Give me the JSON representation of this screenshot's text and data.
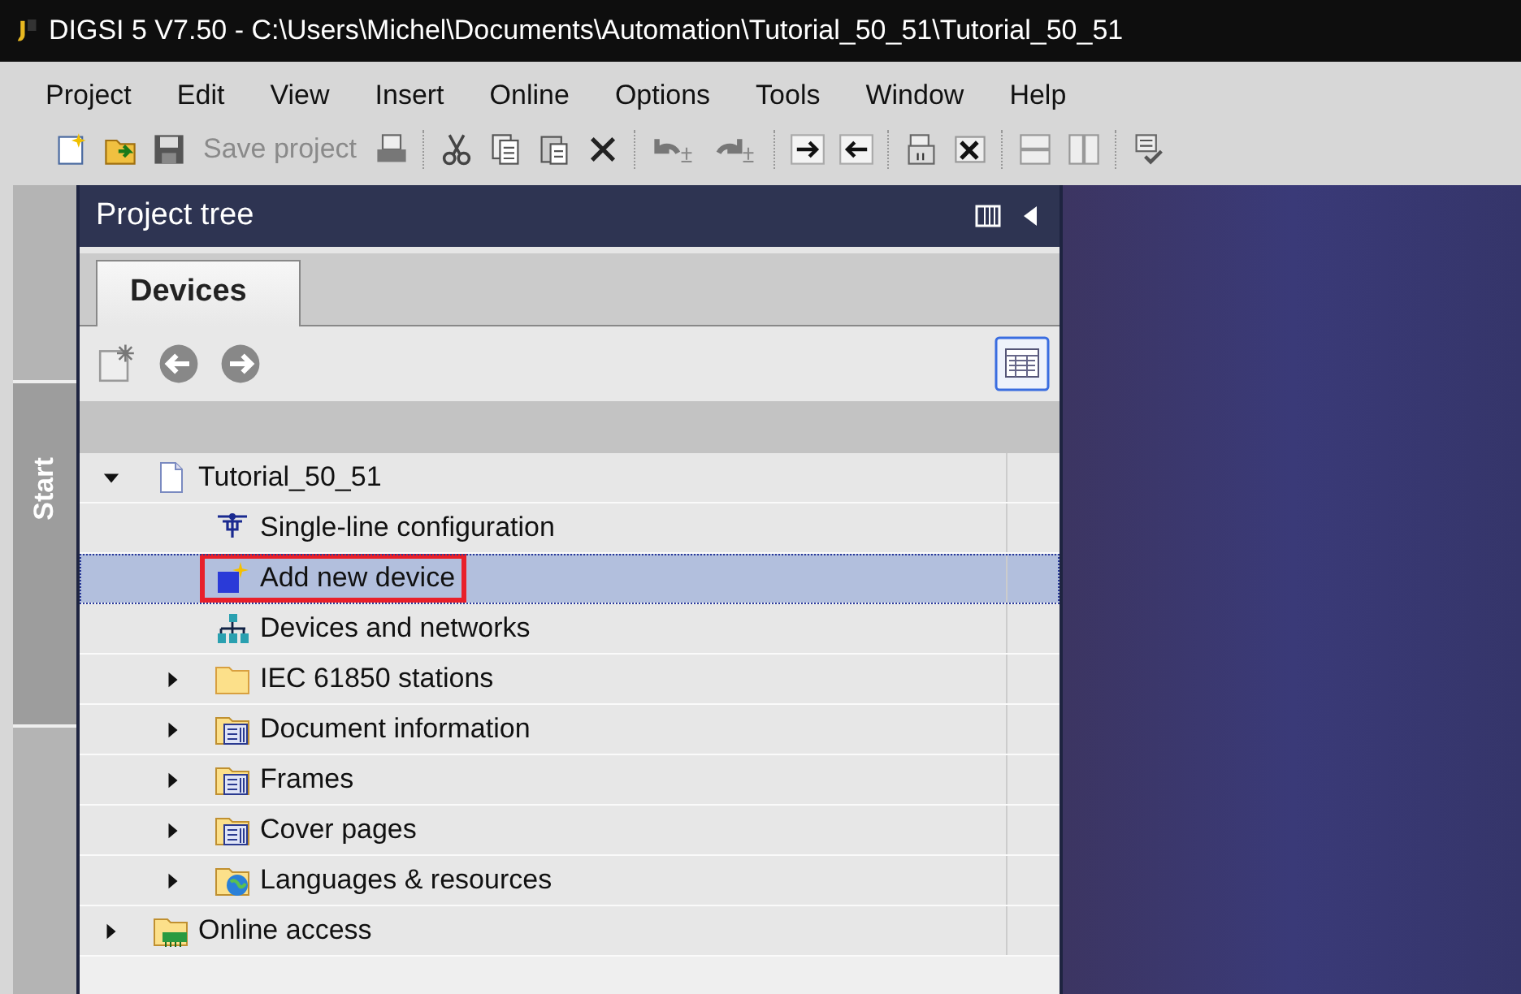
{
  "window": {
    "title": "DIGSI 5 V7.50  -  C:\\Users\\Michel\\Documents\\Automation\\Tutorial_50_51\\Tutorial_50_51"
  },
  "menu": [
    "Project",
    "Edit",
    "View",
    "Insert",
    "Online",
    "Options",
    "Tools",
    "Window",
    "Help"
  ],
  "toolbar": {
    "save_label": "Save project",
    "save_disabled": true
  },
  "side_tab": {
    "label": "Start"
  },
  "project_tree": {
    "title": "Project tree",
    "tabs": [
      {
        "label": "Devices",
        "selected": true
      }
    ],
    "items": [
      {
        "label": "Tutorial_50_51",
        "kind": "project",
        "expanded": true,
        "selected": false,
        "highlighted": false,
        "children": [
          {
            "label": "Single-line configuration",
            "kind": "single-line",
            "selected": false,
            "highlighted": false
          },
          {
            "label": "Add new device",
            "kind": "add-device",
            "selected": true,
            "highlighted": true
          },
          {
            "label": "Devices and networks",
            "kind": "network",
            "selected": false,
            "highlighted": false
          },
          {
            "label": "IEC 61850 stations",
            "kind": "folder",
            "expanded": false,
            "selected": false,
            "highlighted": false
          },
          {
            "label": "Document information",
            "kind": "doc-folder",
            "expanded": false,
            "selected": false,
            "highlighted": false
          },
          {
            "label": "Frames",
            "kind": "doc-folder",
            "expanded": false,
            "selected": false,
            "highlighted": false
          },
          {
            "label": "Cover pages",
            "kind": "doc-folder",
            "expanded": false,
            "selected": false,
            "highlighted": false
          },
          {
            "label": "Languages & resources",
            "kind": "globe-folder",
            "expanded": false,
            "selected": false,
            "highlighted": false
          }
        ]
      },
      {
        "label": "Online access",
        "kind": "online-folder",
        "expanded": false,
        "selected": false,
        "highlighted": false
      }
    ]
  }
}
